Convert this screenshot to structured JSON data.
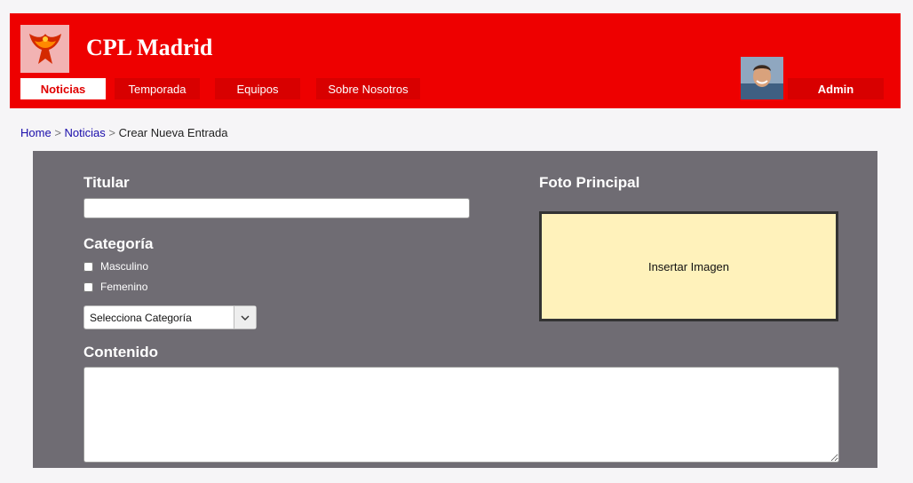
{
  "header": {
    "site_title": "CPL Madrid",
    "nav": [
      "Noticias",
      "Temporada",
      "Equipos",
      "Sobre Nosotros"
    ],
    "user": "Admin",
    "brand_color": "#ee0000"
  },
  "breadcrumb": {
    "home": "Home",
    "section": "Noticias",
    "current": "Crear Nueva Entrada",
    "separator": ">"
  },
  "form": {
    "titular_label": "Titular",
    "categoria_label": "Categoría",
    "categoria_options": [
      "Masculino",
      "Femenino"
    ],
    "select_value": "Selecciona Categoría",
    "contenido_label": "Contenido",
    "foto_label": "Foto Principal",
    "insert_image": "Insertar Imagen"
  }
}
